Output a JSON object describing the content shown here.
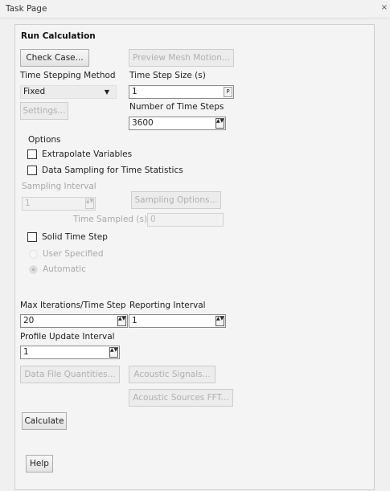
{
  "window": {
    "title": "Task Page",
    "close_glyph": "×"
  },
  "run_calculation": {
    "heading": "Run Calculation",
    "check_case_label": "Check Case...",
    "preview_mesh_motion_label": "Preview Mesh Motion...",
    "time_stepping_method_label": "Time Stepping Method",
    "time_stepping_method_value": "Fixed",
    "time_step_size_label": "Time Step Size (s)",
    "time_step_size_value": "1",
    "time_step_size_param_glyph": "P",
    "settings_label": "Settings...",
    "number_of_time_steps_label": "Number of Time Steps",
    "number_of_time_steps_value": "3600"
  },
  "options": {
    "heading": "Options",
    "extrapolate_variables_label": "Extrapolate Variables",
    "extrapolate_variables_checked": false,
    "data_sampling_label": "Data Sampling for Time Statistics",
    "data_sampling_checked": false,
    "sampling_interval_label": "Sampling Interval",
    "sampling_interval_value": "1",
    "sampling_options_label": "Sampling Options...",
    "time_sampled_label": "Time Sampled (s)",
    "time_sampled_value": "0",
    "solid_time_step_label": "Solid Time Step",
    "solid_time_step_checked": false,
    "user_specified_label": "User Specified",
    "automatic_label": "Automatic",
    "selected_radio": "Automatic"
  },
  "iteration": {
    "max_iterations_label": "Max Iterations/Time Step",
    "max_iterations_value": "20",
    "reporting_interval_label": "Reporting Interval",
    "reporting_interval_value": "1",
    "profile_update_interval_label": "Profile Update Interval",
    "profile_update_interval_value": "1"
  },
  "actions": {
    "data_file_quantities_label": "Data File Quantities...",
    "acoustic_signals_label": "Acoustic Signals...",
    "acoustic_sources_fft_label": "Acoustic Sources FFT...",
    "calculate_label": "Calculate",
    "help_label": "Help"
  },
  "icons": {
    "dropdown_arrow": "▼",
    "spin_glyph": "▲▼"
  },
  "colors": {
    "background": "#f0f0f0",
    "disabled_text": "#a8a8a8",
    "field_border": "#8a8a8a"
  }
}
